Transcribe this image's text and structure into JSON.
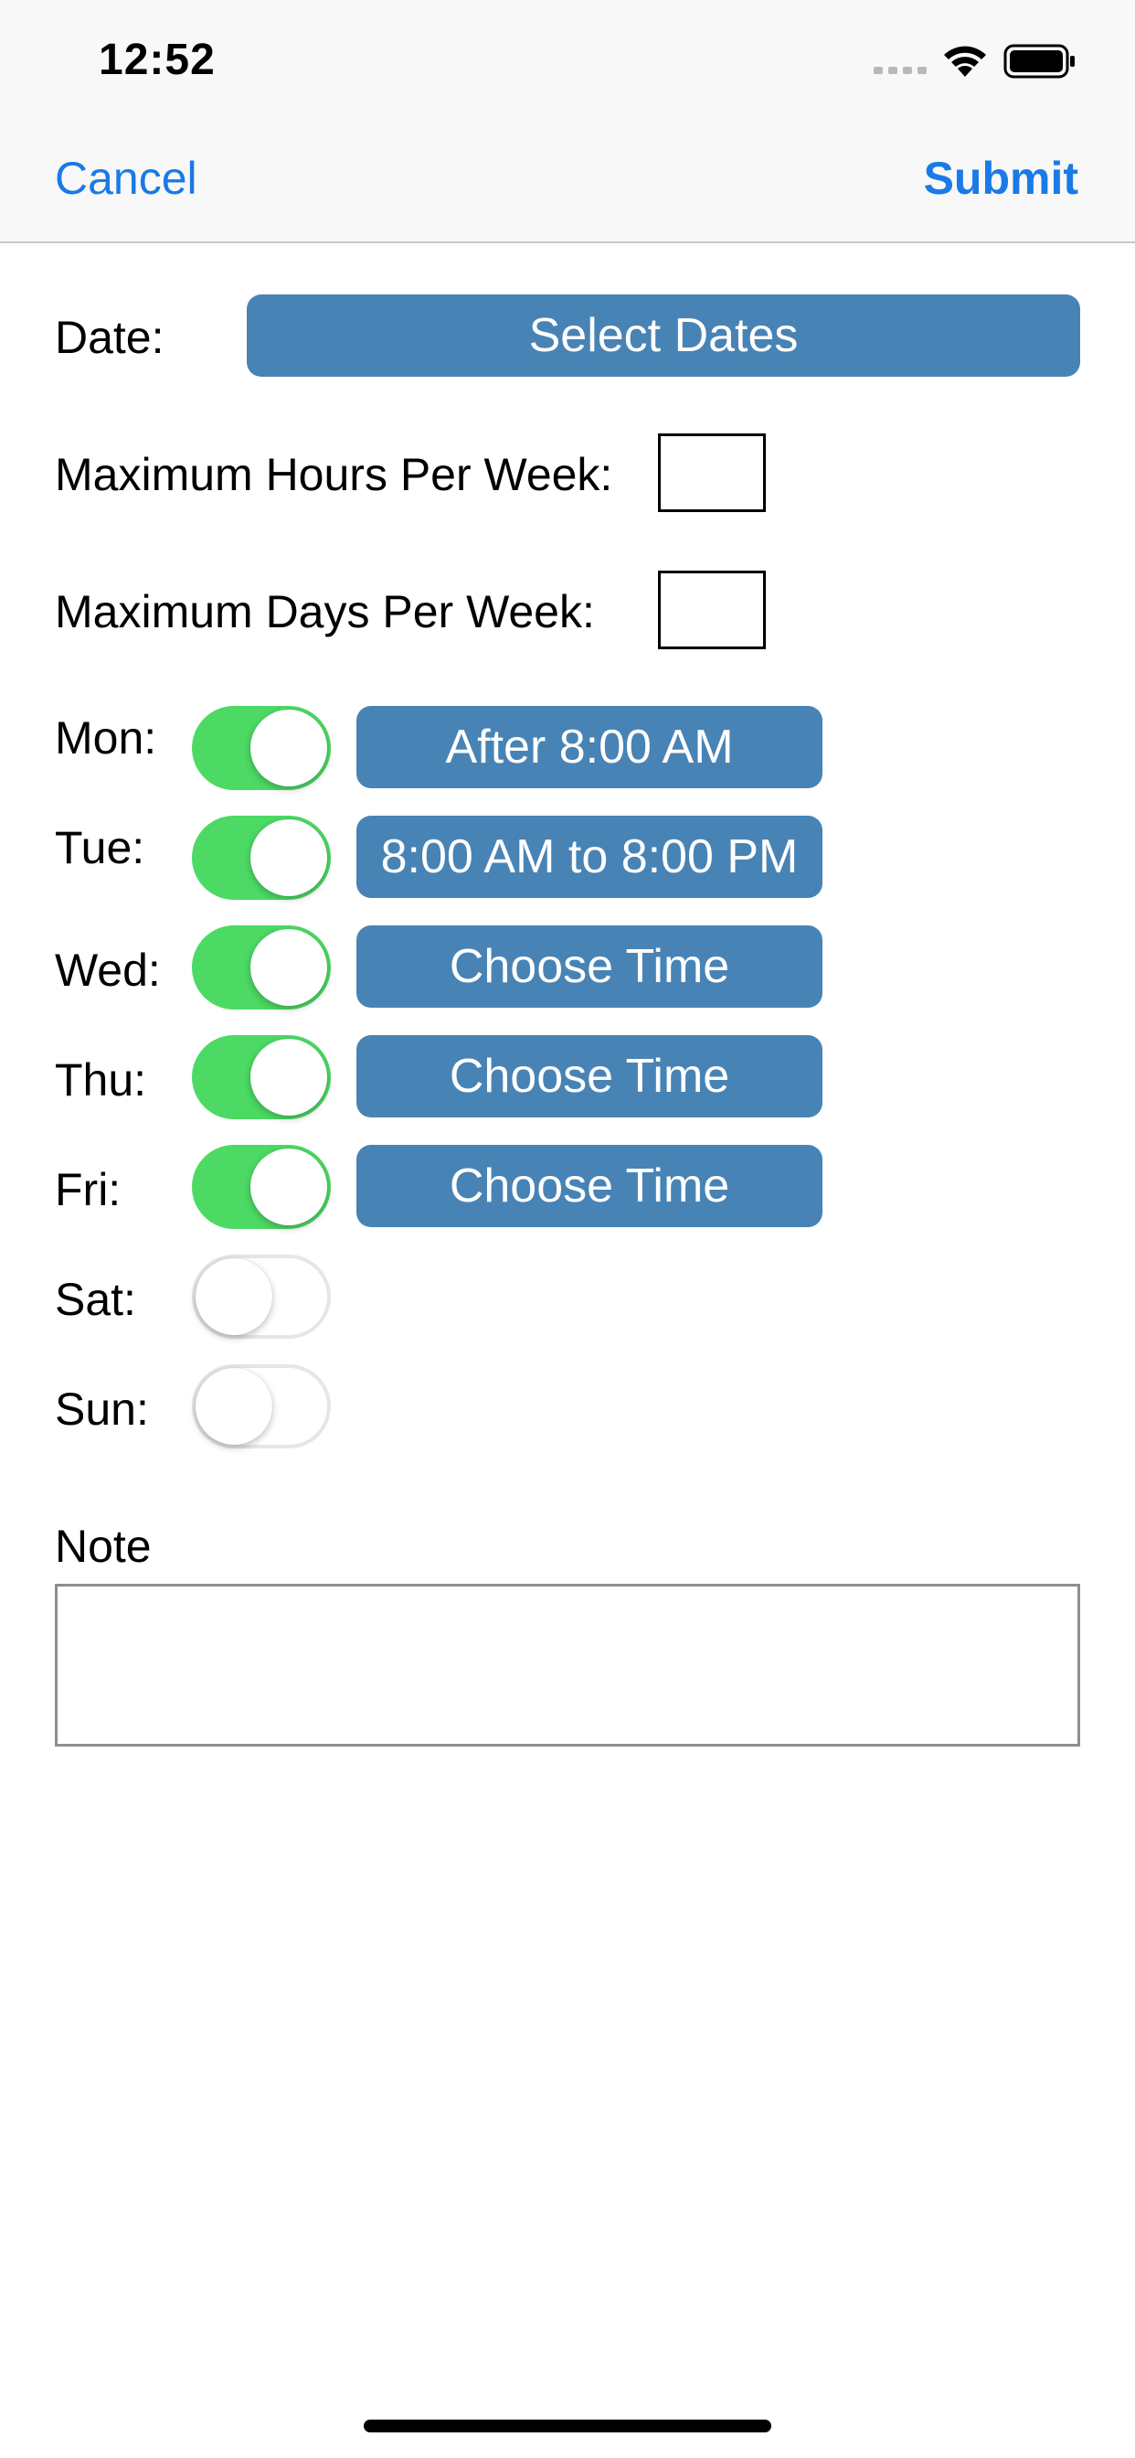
{
  "status_bar": {
    "time": "12:52",
    "icons": [
      "cellular-signal-icon",
      "wifi-icon",
      "battery-icon"
    ]
  },
  "nav": {
    "cancel_label": "Cancel",
    "submit_label": "Submit"
  },
  "form": {
    "date_label": "Date:",
    "select_dates_label": "Select Dates",
    "max_hours_label": "Maximum Hours Per Week:",
    "max_hours_value": "",
    "max_days_label": "Maximum Days Per Week:",
    "max_days_value": "",
    "days": [
      {
        "label": "Mon:",
        "enabled": true,
        "time_label": "After 8:00 AM"
      },
      {
        "label": "Tue:",
        "enabled": true,
        "time_label": "8:00 AM to 8:00 PM"
      },
      {
        "label": "Wed:",
        "enabled": true,
        "time_label": "Choose Time"
      },
      {
        "label": "Thu:",
        "enabled": true,
        "time_label": "Choose Time"
      },
      {
        "label": "Fri:",
        "enabled": true,
        "time_label": "Choose Time"
      },
      {
        "label": "Sat:",
        "enabled": false,
        "time_label": ""
      },
      {
        "label": "Sun:",
        "enabled": false,
        "time_label": ""
      }
    ],
    "note_label": "Note",
    "note_value": ""
  },
  "colors": {
    "accent": "#1a7ae6",
    "button_blue": "#4883b5",
    "toggle_on": "#4cd964",
    "toggle_off_border": "#e5e5ea"
  }
}
